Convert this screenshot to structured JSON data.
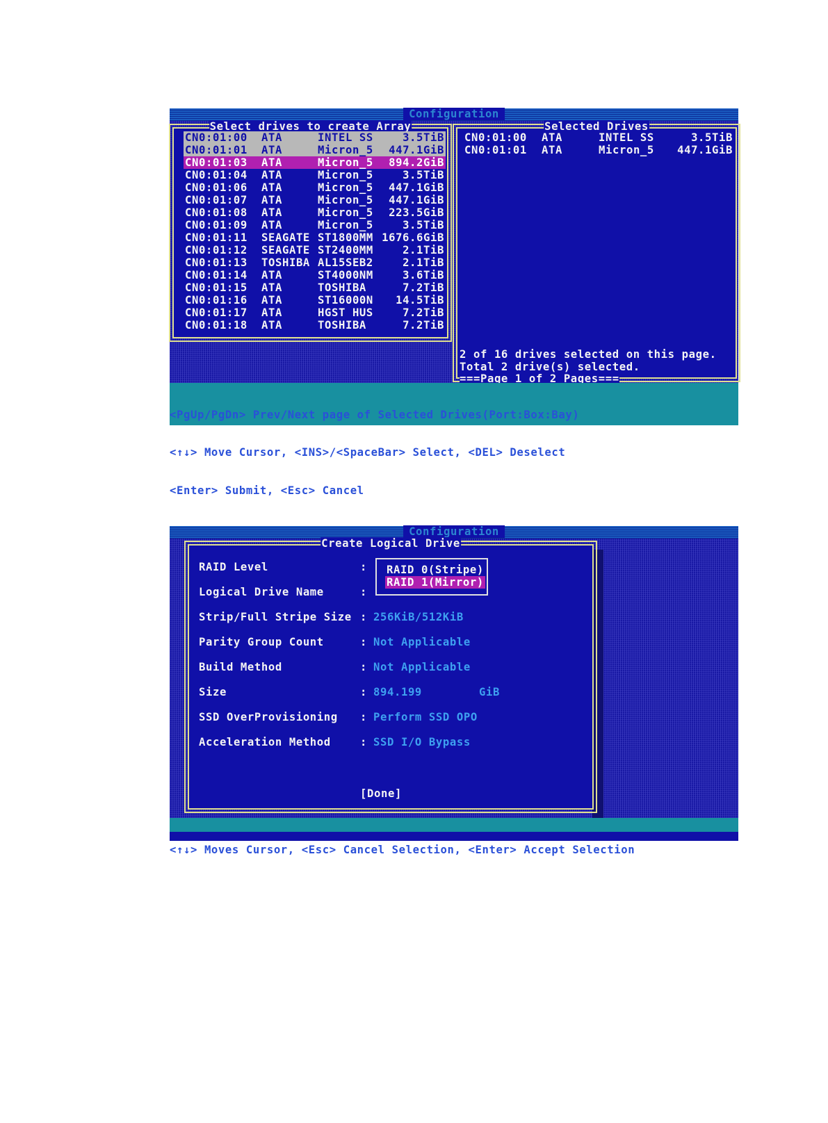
{
  "screen1": {
    "title": "Configuration",
    "left_panel": {
      "title": "Select drives to create Array",
      "rows": [
        {
          "id": "CN0:01:00",
          "vendor": "ATA",
          "model": "INTEL SS",
          "size": "3.5TiB",
          "state": "selected"
        },
        {
          "id": "CN0:01:01",
          "vendor": "ATA",
          "model": "Micron_5",
          "size": "447.1GiB",
          "state": "selected"
        },
        {
          "id": "CN0:01:03",
          "vendor": "ATA",
          "model": "Micron_5",
          "size": "894.2GiB",
          "state": "cursor"
        },
        {
          "id": "CN0:01:04",
          "vendor": "ATA",
          "model": "Micron_5",
          "size": "3.5TiB",
          "state": "normal"
        },
        {
          "id": "CN0:01:06",
          "vendor": "ATA",
          "model": "Micron_5",
          "size": "447.1GiB",
          "state": "normal"
        },
        {
          "id": "CN0:01:07",
          "vendor": "ATA",
          "model": "Micron_5",
          "size": "447.1GiB",
          "state": "normal"
        },
        {
          "id": "CN0:01:08",
          "vendor": "ATA",
          "model": "Micron_5",
          "size": "223.5GiB",
          "state": "normal"
        },
        {
          "id": "CN0:01:09",
          "vendor": "ATA",
          "model": "Micron_5",
          "size": "3.5TiB",
          "state": "normal"
        },
        {
          "id": "CN0:01:11",
          "vendor": "SEAGATE",
          "model": "ST1800MM",
          "size": "1676.6GiB",
          "state": "normal"
        },
        {
          "id": "CN0:01:12",
          "vendor": "SEAGATE",
          "model": "ST2400MM",
          "size": "2.1TiB",
          "state": "normal"
        },
        {
          "id": "CN0:01:13",
          "vendor": "TOSHIBA",
          "model": "AL15SEB2",
          "size": "2.1TiB",
          "state": "normal"
        },
        {
          "id": "CN0:01:14",
          "vendor": "ATA",
          "model": "ST4000NM",
          "size": "3.6TiB",
          "state": "normal"
        },
        {
          "id": "CN0:01:15",
          "vendor": "ATA",
          "model": "TOSHIBA",
          "size": "7.2TiB",
          "state": "normal"
        },
        {
          "id": "CN0:01:16",
          "vendor": "ATA",
          "model": "ST16000N",
          "size": "14.5TiB",
          "state": "normal"
        },
        {
          "id": "CN0:01:17",
          "vendor": "ATA",
          "model": "HGST HUS",
          "size": "7.2TiB",
          "state": "normal"
        },
        {
          "id": "CN0:01:18",
          "vendor": "ATA",
          "model": "TOSHIBA",
          "size": "7.2TiB",
          "state": "normal"
        }
      ]
    },
    "right_panel": {
      "title": "Selected Drives",
      "rows": [
        {
          "id": "CN0:01:00",
          "vendor": "ATA",
          "model": "INTEL SS",
          "size": "3.5TiB"
        },
        {
          "id": "CN0:01:01",
          "vendor": "ATA",
          "model": "Micron_5",
          "size": "447.1GiB"
        }
      ],
      "status_line1": "2 of 16 drives selected on this page.",
      "status_line2": "Total 2 drive(s) selected.",
      "page_indicator": "===Page 1 of 2 Pages==="
    },
    "help": [
      "<PgUp/PgDn> Prev/Next page of Selected Drives(Port:Box:Bay)",
      "<↑↓> Move Cursor, <INS>/<SpaceBar> Select, <DEL> Deselect",
      "<Enter> Submit, <Esc> Cancel"
    ]
  },
  "screen2": {
    "title": "Configuration",
    "dialog_title": "Create Logical Drive",
    "fields": [
      {
        "label": "RAID Level",
        "value": ""
      },
      {
        "label": "Logical Drive Name",
        "value": ""
      },
      {
        "label": "Strip/Full Stripe Size",
        "value": "256KiB/512KiB"
      },
      {
        "label": "Parity Group Count",
        "value": "Not Applicable"
      },
      {
        "label": "Build Method",
        "value": "Not Applicable"
      },
      {
        "label": "Size",
        "value": "894.199"
      },
      {
        "label": "SSD OverProvisioning",
        "value": "Perform SSD OPO"
      },
      {
        "label": "Acceleration Method",
        "value": "SSD I/O Bypass"
      }
    ],
    "colon": ":",
    "size_unit": "GiB",
    "raid_options": [
      "RAID 0(Stripe)",
      "RAID 1(Mirror)"
    ],
    "raid_selected_index": 1,
    "done_label": "[Done]",
    "help": "<↑↓> Moves Cursor, <Esc> Cancel Selection, <Enter> Accept Selection"
  },
  "colors": {
    "background": "#1010a8",
    "highlight": "#b020b0",
    "selected_row": "#b8b8b8",
    "frame": "#e0e090",
    "value_text": "#3ea0f0",
    "help_bar": "#1890a0"
  }
}
